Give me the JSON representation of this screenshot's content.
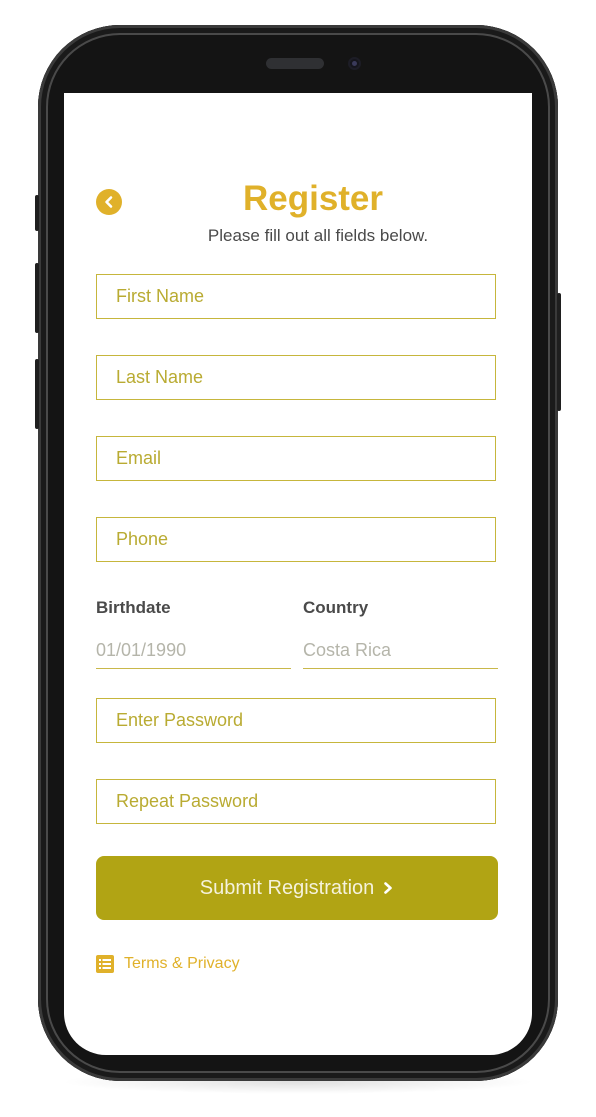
{
  "header": {
    "title": "Register",
    "subtitle": "Please fill out all fields below.",
    "back_icon": "chevron-left-circle-icon"
  },
  "form": {
    "first_name": {
      "placeholder": "First Name",
      "value": ""
    },
    "last_name": {
      "placeholder": "Last Name",
      "value": ""
    },
    "email": {
      "placeholder": "Email",
      "value": ""
    },
    "phone": {
      "placeholder": "Phone",
      "value": ""
    },
    "birthdate": {
      "label": "Birthdate",
      "placeholder": "01/01/1990",
      "value": ""
    },
    "country": {
      "label": "Country",
      "placeholder": "Costa Rica",
      "value": ""
    },
    "password": {
      "placeholder": "Enter Password",
      "value": ""
    },
    "repeat_password": {
      "placeholder": "Repeat Password",
      "value": ""
    }
  },
  "submit": {
    "label": "Submit Registration",
    "icon": "chevron-right-icon"
  },
  "terms": {
    "label": "Terms & Privacy",
    "icon": "list-icon"
  },
  "colors": {
    "accent": "#e0b12a",
    "button": "#b1a414",
    "field_border": "#c6b63c",
    "placeholder": "#b9ab32",
    "text_dark": "#4a4a4a"
  }
}
